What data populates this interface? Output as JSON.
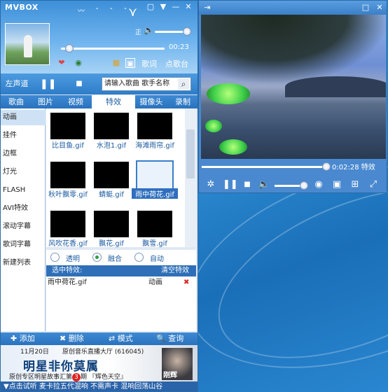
{
  "mvbox": {
    "logo": "MVBOX",
    "window_buttons": [
      "▢",
      "▼",
      "—",
      "✕"
    ],
    "volume_label": "正",
    "time": "00:23",
    "head_links": [
      "歌词",
      "点歌台"
    ],
    "controls": {
      "channel": "左声道",
      "search_placeholder": "请输入歌曲 歌手名称"
    },
    "tabs": [
      "歌曲",
      "图片",
      "视频",
      "特效",
      "摄像头",
      "录制"
    ],
    "sidebar": [
      "动画",
      "挂件",
      "边框",
      "灯光",
      "FLASH",
      "AVI特效",
      "滚动字幕",
      "歌词字幕",
      "新建列表"
    ],
    "thumbnails": [
      {
        "caption": "比目鱼.gif"
      },
      {
        "caption": "水泡1.gif"
      },
      {
        "caption": "海滩雨帘.gif"
      },
      {
        "caption": "秋叶飘零.gif"
      },
      {
        "caption": "蜻蜓.gif"
      },
      {
        "caption": "雨中荷花.gif"
      },
      {
        "caption": "风吹花香.gif"
      },
      {
        "caption": "飘花.gif"
      },
      {
        "caption": "飘雪.gif"
      }
    ],
    "modes": [
      "透明",
      "融合",
      "自动"
    ],
    "selected_list": {
      "header": "选中特效:",
      "clear": "清空特效",
      "row_name": "雨中荷花.gif",
      "row_type": "动画"
    },
    "bottom_buttons": [
      "✚ 添加",
      "✖ 删除",
      "⇄ 模式",
      "🔍 查询"
    ],
    "ad": {
      "date": "11月20日",
      "top_line": "原创音乐直播大厅 (616045)",
      "title": "明星非你莫属",
      "sub_prefix": "原创专区明星故事汇第",
      "sub_num": "3",
      "sub_suffix": "期 『辉色天空』",
      "name": "刚辉"
    },
    "ticker": "▼点击试听  麦卡拉五代混响  不需声卡  混响回荡山谷"
  },
  "player": {
    "title_icon": "⇥",
    "time": "0:02:28",
    "fx_label": "特效",
    "progress": 0.96
  }
}
